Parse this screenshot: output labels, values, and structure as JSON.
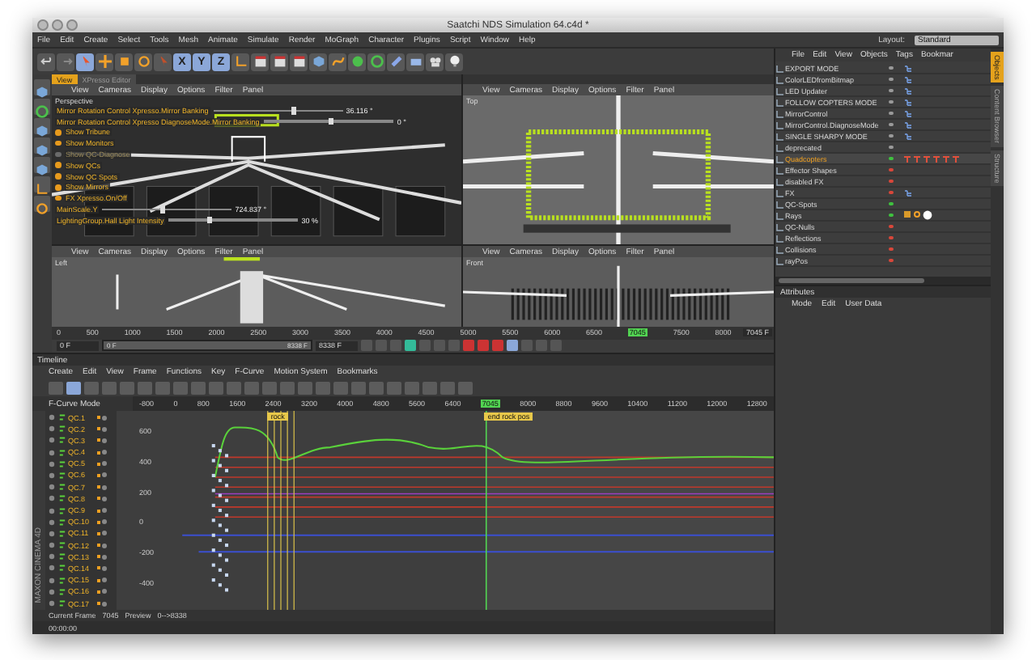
{
  "window": {
    "title": "Saatchi NDS Simulation 64.c4d *"
  },
  "menu": [
    "File",
    "Edit",
    "Create",
    "Select",
    "Tools",
    "Mesh",
    "Animate",
    "Simulate",
    "Render",
    "MoGraph",
    "Character",
    "Plugins",
    "Script",
    "Window",
    "Help"
  ],
  "layout": {
    "label": "Layout:",
    "value": "Standard"
  },
  "toolbar": [
    {
      "kind": "undo",
      "selected": false
    },
    {
      "kind": "redo",
      "selected": false
    },
    {
      "kind": "select",
      "selected": true
    },
    {
      "kind": "move",
      "selected": false
    },
    {
      "kind": "scale",
      "selected": false
    },
    {
      "kind": "rotate",
      "selected": false
    },
    {
      "kind": "last",
      "selected": false
    },
    {
      "kind": "axis",
      "label": "X",
      "selected": true
    },
    {
      "kind": "axis",
      "label": "Y",
      "selected": true
    },
    {
      "kind": "axis",
      "label": "Z",
      "selected": true
    },
    {
      "kind": "coords",
      "selected": false
    },
    {
      "kind": "render",
      "selected": false
    },
    {
      "kind": "render",
      "selected": false
    },
    {
      "kind": "render",
      "selected": false
    },
    {
      "kind": "cube",
      "selected": false
    },
    {
      "kind": "spline",
      "selected": false
    },
    {
      "kind": "nurbs",
      "selected": false
    },
    {
      "kind": "array",
      "selected": false
    },
    {
      "kind": "deform",
      "selected": false
    },
    {
      "kind": "floor",
      "selected": false
    },
    {
      "kind": "camera",
      "selected": false
    },
    {
      "kind": "light",
      "selected": false
    }
  ],
  "view_tabs": [
    {
      "label": "View",
      "selected": true
    },
    {
      "label": "XPresso Editor",
      "selected": false
    }
  ],
  "viewports": [
    {
      "camera": "Perspective",
      "menu": [
        "View",
        "Cameras",
        "Display",
        "Options",
        "Filter",
        "Panel"
      ],
      "controls": [
        {
          "kind": "slider",
          "label": "Mirror Rotation Control Xpresso.Mirror Banking",
          "value": "36.116 °",
          "level": 0.6
        },
        {
          "kind": "slider",
          "label": "Mirror Rotation Control Xpresso DiagnoseMode.Mirror Banking",
          "value": "0 °",
          "level": 0.5
        },
        {
          "kind": "toggle",
          "label": "Show Tribune",
          "checked": true
        },
        {
          "kind": "toggle",
          "label": "Show Monitors",
          "checked": true
        },
        {
          "kind": "toggle",
          "label": "Show QC-Diagnose",
          "checked": false
        },
        {
          "kind": "toggle",
          "label": "Show QCs",
          "checked": true
        },
        {
          "kind": "toggle",
          "label": "Show QC Spots",
          "checked": true
        },
        {
          "kind": "toggle",
          "label": "Show Mirrors",
          "checked": true
        },
        {
          "kind": "toggle",
          "label": "FX Xpresso.On/Off",
          "checked": true
        },
        {
          "kind": "slider",
          "label": "MainScale.Y",
          "value": "724.837 °",
          "level": 0.45
        },
        {
          "kind": "slider",
          "label": "LightingGroup.Hall Light Intensity",
          "value": "30 %",
          "level": 0.3
        }
      ]
    },
    {
      "camera": "Top",
      "menu": [
        "View",
        "Cameras",
        "Display",
        "Options",
        "Filter",
        "Panel"
      ]
    },
    {
      "camera": "Left",
      "menu": [
        "View",
        "Cameras",
        "Display",
        "Options",
        "Filter",
        "Panel"
      ]
    },
    {
      "camera": "Front",
      "menu": [
        "View",
        "Cameras",
        "Display",
        "Options",
        "Filter",
        "Panel"
      ]
    }
  ],
  "frame_ruler": {
    "labels": [
      {
        "label": "0",
        "current": false
      },
      {
        "label": "500",
        "current": false
      },
      {
        "label": "1000",
        "current": false
      },
      {
        "label": "1500",
        "current": false
      },
      {
        "label": "2000",
        "current": false
      },
      {
        "label": "2500",
        "current": false
      },
      {
        "label": "3000",
        "current": false
      },
      {
        "label": "3500",
        "current": false
      },
      {
        "label": "4000",
        "current": false
      },
      {
        "label": "4500",
        "current": false
      },
      {
        "label": "5000",
        "current": false
      },
      {
        "label": "5500",
        "current": false
      },
      {
        "label": "6000",
        "current": false
      },
      {
        "label": "6500",
        "current": false
      },
      {
        "label": "7045",
        "current": true
      },
      {
        "label": "7500",
        "current": false
      },
      {
        "label": "8000",
        "current": false
      }
    ],
    "end": "7045 F"
  },
  "transport": {
    "start": "0 F",
    "range": {
      "start": "0 F",
      "end": "8338 F",
      "level": 1
    },
    "end": "8338 F"
  },
  "timeline": {
    "title": "Timeline",
    "menu": [
      "Create",
      "Edit",
      "View",
      "Frame",
      "Functions",
      "Key",
      "F-Curve",
      "Motion System",
      "Bookmarks"
    ],
    "mode": "F-Curve Mode",
    "ruler": [
      {
        "label": "-800",
        "current": false
      },
      {
        "label": "0",
        "current": false
      },
      {
        "label": "800",
        "current": false
      },
      {
        "label": "1600",
        "current": false
      },
      {
        "label": "2400",
        "current": false
      },
      {
        "label": "3200",
        "current": false
      },
      {
        "label": "4000",
        "current": false
      },
      {
        "label": "4800",
        "current": false
      },
      {
        "label": "5600",
        "current": false
      },
      {
        "label": "6400",
        "current": false
      },
      {
        "label": "7045",
        "current": true
      },
      {
        "label": "8000",
        "current": false
      },
      {
        "label": "8800",
        "current": false
      },
      {
        "label": "9600",
        "current": false
      },
      {
        "label": "10400",
        "current": false
      },
      {
        "label": "11200",
        "current": false
      },
      {
        "label": "12000",
        "current": false
      },
      {
        "label": "12800",
        "current": false
      }
    ],
    "markers": [
      "rock",
      "end rock pos"
    ],
    "y_labels": [
      "600",
      "400",
      "200",
      "0",
      "-200",
      "-400"
    ],
    "tracks": [
      "QC.1",
      "QC.2",
      "QC.3",
      "QC.4",
      "QC.5",
      "QC.6",
      "QC.7",
      "QC.8",
      "QC.9",
      "QC.10",
      "QC.11",
      "QC.12",
      "QC.13",
      "QC.14",
      "QC.15",
      "QC.16",
      "QC.17"
    ],
    "status": [
      {
        "label": "Current Frame",
        "value": "7045"
      },
      {
        "label": "Preview",
        "value": "0-->8338"
      }
    ],
    "logo": "MAXON CINEMA 4D",
    "time": "00:00:00"
  },
  "object_manager": {
    "menu": [
      "File",
      "Edit",
      "View",
      "Objects",
      "Tags",
      "Bookmar"
    ],
    "objects": [
      {
        "name": "EXPORT MODE",
        "color": "#9a9a9a",
        "selected": false
      },
      {
        "name": "ColorLEDfromBitmap",
        "color": "#9a9a9a",
        "selected": false
      },
      {
        "name": "LED Updater",
        "color": "#9a9a9a",
        "selected": false
      },
      {
        "name": "FOLLOW COPTERS MODE",
        "color": "#9a9a9a",
        "selected": false
      },
      {
        "name": "MirrorControl",
        "color": "#9a9a9a",
        "selected": false
      },
      {
        "name": "MirrorControl.DiagnoseMode",
        "color": "#9a9a9a",
        "selected": false
      },
      {
        "name": "SINGLE SHARPY MODE",
        "color": "#9a9a9a",
        "selected": false
      },
      {
        "name": "deprecated",
        "color": "#9a9a9a",
        "selected": false
      },
      {
        "name": "Quadcopters",
        "color": "#3fc23f",
        "selected": true
      },
      {
        "name": "Effector Shapes",
        "color": "#d9473a",
        "selected": false
      },
      {
        "name": "disabled FX",
        "color": "#d9473a",
        "selected": false
      },
      {
        "name": "FX",
        "color": "#d9473a",
        "selected": false
      },
      {
        "name": "QC-Spots",
        "color": "#3fc23f",
        "selected": false
      },
      {
        "name": "Rays",
        "color": "#3fc23f",
        "selected": false
      },
      {
        "name": "QC-Nulls",
        "color": "#d9473a",
        "selected": false
      },
      {
        "name": "Reflections",
        "color": "#d9473a",
        "selected": false
      },
      {
        "name": "Collisions",
        "color": "#d9473a",
        "selected": false
      },
      {
        "name": "rayPos",
        "color": "#d9473a",
        "selected": false
      }
    ]
  },
  "side_tabs": [
    {
      "label": "Objects",
      "selected": true
    },
    {
      "label": "Content Browser",
      "selected": false
    },
    {
      "label": "Structure",
      "selected": false
    }
  ],
  "attributes": {
    "title": "Attributes",
    "menu": [
      "Mode",
      "Edit",
      "User Data"
    ]
  }
}
